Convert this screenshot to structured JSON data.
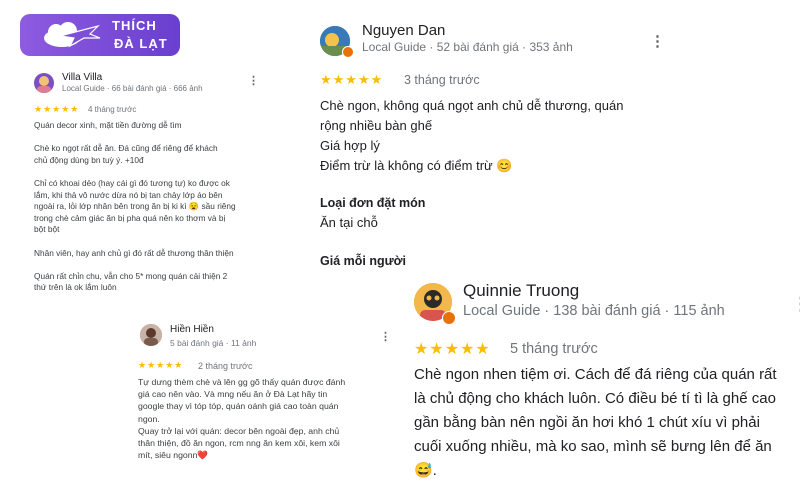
{
  "logo": {
    "line1": "THÍCH",
    "line2": "ĐÀ LẠT"
  },
  "reviews": [
    {
      "name": "Villa Villa",
      "meta": "Local Guide · 66 bài đánh giá · 666 ảnh",
      "stars": "★★★★★",
      "ago": "4 tháng trước",
      "lines": [
        "Quán decor xinh, mặt tiền đường dễ tìm",
        "",
        "Chè ko ngọt rất dễ ăn. Đá cũng để riêng để khách",
        "chủ động dùng bn tuỳ ý. +10đ",
        "",
        "Chỉ có khoai dẻo (hay cái gì đó tương tự) ko được ok",
        "lắm, khi thả vô nước dừa nó bị tan chảy lớp áo bên",
        "ngoài ra, lỏi lớp nhân bên trong ăn bị ki kì 😧 sầu riêng",
        "trong chè cảm giác ăn bị pha quá nên ko thơm và bị",
        "bột bột",
        "",
        "Nhân viên, hay anh chủ gì đó rất dễ thương thân thiện",
        "",
        "Quán rất chỉn chu, vẫn cho 5* mong quán cải thiện 2",
        "thứ trên là ok lắm luôn"
      ]
    },
    {
      "name": "Nguyen Dan",
      "meta": "Local Guide · 52 bài đánh giá · 353 ảnh",
      "stars": "★★★★★",
      "ago": "3 tháng trước",
      "lines": [
        "Chè ngon, không quá ngọt anh chủ dễ thương, quán",
        "rộng nhiều bàn ghế",
        "Giá hợp lý",
        "Điểm trừ là không có điểm trừ 😊"
      ],
      "order_type_label": "Loại đơn đặt món",
      "order_type_value": "Ăn tại chỗ",
      "price_label": "Giá mỗi người"
    },
    {
      "name": "Hiền Hiền",
      "meta": "5 bài đánh giá · 11 ảnh",
      "stars": "★★★★★",
      "ago": "2 tháng trước",
      "lines": [
        "Tự dưng thèm chè và lên gg gõ thấy quán được đánh",
        "giá cao nên vào. Và mng nếu ăn ở Đà Lạt hãy tin",
        "google thay vì tóp tóp, quán oánh giá cao toàn quán",
        "ngon.",
        "Quay trở lại với quán: decor bên ngoài đẹp, anh chủ",
        "thân thiện, đồ ăn ngon, rcm nng ăn kem xôi, kem xôi",
        "mít, siêu ngonn❤️"
      ]
    },
    {
      "name": "Quinnie Truong",
      "meta": "Local Guide · 138 bài đánh giá · 115 ảnh",
      "stars": "★★★★★",
      "ago": "5 tháng trước",
      "lines": [
        "Chè ngon nhen tiệm ơi. Cách để đá riêng của quán rất",
        "là chủ động cho khách luôn. Có điều bé tí tì là ghế cao",
        "gần bằng bàn nên ngồi ăn hơi khó 1 chút xíu vì phải",
        "cuối xuống nhiều, mà ko sao, mình sẽ bưng lên để ăn",
        "😅."
      ]
    }
  ],
  "more_icon": "⋮",
  "colors": {
    "star": "#fbbc04",
    "meta": "#70757a",
    "logo": "#7b4fd6",
    "guide_badge": "#e8710a"
  }
}
